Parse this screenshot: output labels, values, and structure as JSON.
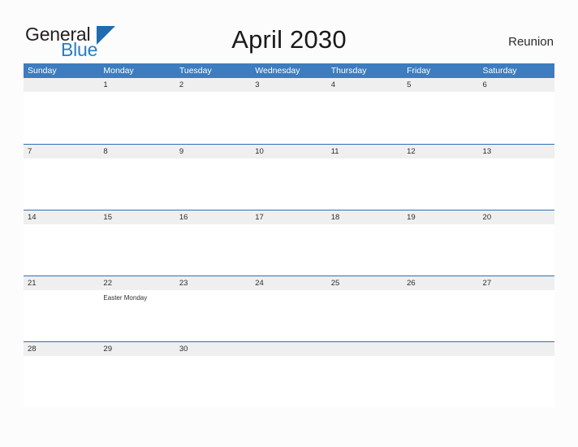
{
  "brand": {
    "name_part1": "General",
    "name_part2": "Blue",
    "triangle_icon": "triangle-icon",
    "accent_color": "#2b7cc3",
    "header_color": "#3c7cbf"
  },
  "header": {
    "title": "April 2030",
    "locale": "Reunion"
  },
  "calendar": {
    "weekdays": [
      "Sunday",
      "Monday",
      "Tuesday",
      "Wednesday",
      "Thursday",
      "Friday",
      "Saturday"
    ],
    "weeks": [
      [
        {
          "date": "",
          "events": []
        },
        {
          "date": "1",
          "events": []
        },
        {
          "date": "2",
          "events": []
        },
        {
          "date": "3",
          "events": []
        },
        {
          "date": "4",
          "events": []
        },
        {
          "date": "5",
          "events": []
        },
        {
          "date": "6",
          "events": []
        }
      ],
      [
        {
          "date": "7",
          "events": []
        },
        {
          "date": "8",
          "events": []
        },
        {
          "date": "9",
          "events": []
        },
        {
          "date": "10",
          "events": []
        },
        {
          "date": "11",
          "events": []
        },
        {
          "date": "12",
          "events": []
        },
        {
          "date": "13",
          "events": []
        }
      ],
      [
        {
          "date": "14",
          "events": []
        },
        {
          "date": "15",
          "events": []
        },
        {
          "date": "16",
          "events": []
        },
        {
          "date": "17",
          "events": []
        },
        {
          "date": "18",
          "events": []
        },
        {
          "date": "19",
          "events": []
        },
        {
          "date": "20",
          "events": []
        }
      ],
      [
        {
          "date": "21",
          "events": []
        },
        {
          "date": "22",
          "events": [
            "Easter Monday"
          ]
        },
        {
          "date": "23",
          "events": []
        },
        {
          "date": "24",
          "events": []
        },
        {
          "date": "25",
          "events": []
        },
        {
          "date": "26",
          "events": []
        },
        {
          "date": "27",
          "events": []
        }
      ],
      [
        {
          "date": "28",
          "events": []
        },
        {
          "date": "29",
          "events": []
        },
        {
          "date": "30",
          "events": []
        },
        {
          "date": "",
          "events": []
        },
        {
          "date": "",
          "events": []
        },
        {
          "date": "",
          "events": []
        },
        {
          "date": "",
          "events": []
        }
      ]
    ]
  }
}
